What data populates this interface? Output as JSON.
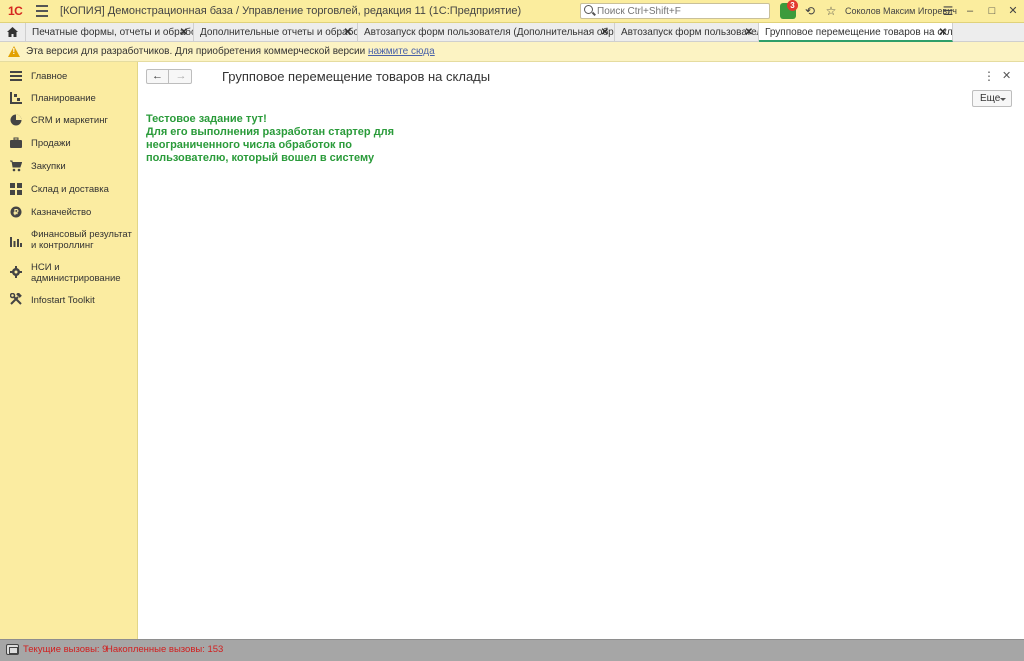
{
  "titlebar": {
    "logo": "1С",
    "app_title": "[КОПИЯ] Демонстрационная база / Управление торговлей, редакция 11  (1С:Предприятие)",
    "search_placeholder": "Поиск Ctrl+Shift+F",
    "notifications_count": "3",
    "user_name": "Соколов Максим Игоревич"
  },
  "tabs": [
    {
      "label": "Печатные формы, отчеты и обработки",
      "active": false
    },
    {
      "label": "Дополнительные отчеты и обработки",
      "active": false
    },
    {
      "label": "Автозапуск форм пользователя (Дополнительная обработка)",
      "active": false
    },
    {
      "label": "Автозапуск форм пользователя",
      "active": false
    },
    {
      "label": "Групповое перемещение товаров на склады",
      "active": true
    }
  ],
  "warning": {
    "message": "Эта версия для разработчиков. Для приобретения коммерческой версии",
    "link": "нажмите сюда"
  },
  "sidebar": {
    "items": [
      {
        "label": "Главное",
        "icon": "menu-icon"
      },
      {
        "label": "Планирование",
        "icon": "planning-icon"
      },
      {
        "label": "CRM и маркетинг",
        "icon": "pie-chart-icon"
      },
      {
        "label": "Продажи",
        "icon": "briefcase-icon"
      },
      {
        "label": "Закупки",
        "icon": "cart-icon"
      },
      {
        "label": "Склад и доставка",
        "icon": "warehouse-icon"
      },
      {
        "label": "Казначейство",
        "icon": "coin-icon"
      },
      {
        "label": "Финансовый результат и контроллинг",
        "icon": "bar-chart-icon"
      },
      {
        "label": "НСИ и администрирование",
        "icon": "gear-icon"
      },
      {
        "label": "Infostart Toolkit",
        "icon": "tools-icon"
      }
    ]
  },
  "form": {
    "title": "Групповое перемещение товаров на склады",
    "more_button": "Еще",
    "text_lines": [
      "Тестовое задание тут!",
      "Для его выполнения разработан стартер для",
      "неограниченного числа обработок по",
      "пользователю, который вошел в систему"
    ]
  },
  "statusbar": {
    "current_calls": "Текущие вызовы: 9",
    "accumulated_calls": "Накопленные вызовы: 153"
  }
}
